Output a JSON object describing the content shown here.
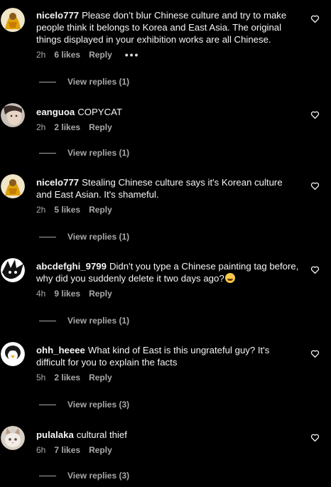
{
  "comments": [
    {
      "username": "nicelo777",
      "text": "Please don’t blur Chinese culture and try to make people think it belongs to Korea and East Asia. The original things displayed in your exhibition works are all Chinese.",
      "time": "2h",
      "likes": "6 likes",
      "reply": "Reply",
      "more": "•••",
      "view_replies": "View replies (1)",
      "avatar": "golden-figure-avatar"
    },
    {
      "username": "eanguoa",
      "text": "COPYCAT",
      "time": "2h",
      "likes": "2 likes",
      "reply": "Reply",
      "view_replies": "View replies (1)",
      "avatar": "face-photo-avatar"
    },
    {
      "username": "nicelo777",
      "text": "Stealing Chinese culture says it's Korean culture and East Asian. It's shameful.",
      "time": "2h",
      "likes": "5 likes",
      "reply": "Reply",
      "view_replies": "View replies (1)",
      "avatar": "golden-figure-avatar"
    },
    {
      "username": "abcdefghi_9799",
      "text": "Didn't you type a Chinese painting tag before, why did you suddenly delete it two days ago?",
      "emoji": "laughing-emoji",
      "time": "4h",
      "likes": "9 likes",
      "reply": "Reply",
      "view_replies": "View replies (1)",
      "avatar": "black-white-anime-avatar"
    },
    {
      "username": "ohh_heeee",
      "text": "What kind of East is this ungrateful guy? It's difficult for you to explain the facts",
      "time": "5h",
      "likes": "2 likes",
      "reply": "Reply",
      "view_replies": "View replies (3)",
      "avatar": "penguin-avatar"
    },
    {
      "username": "pulalaka",
      "text": "cultural thief",
      "time": "6h",
      "likes": "7 likes",
      "reply": "Reply",
      "view_replies": "View replies (3)",
      "avatar": "cat-avatar"
    }
  ],
  "icons": {
    "like": "heart-outline-icon"
  },
  "colors": {
    "background": "#000000",
    "text": "#f5f5f5",
    "secondary": "#a8a8a8"
  }
}
